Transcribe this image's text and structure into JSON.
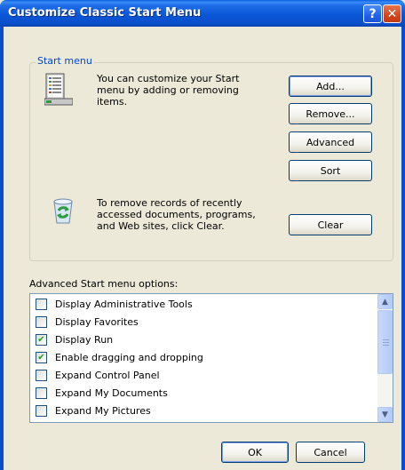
{
  "window": {
    "title": "Customize Classic Start Menu",
    "help_label": "?",
    "close_label": "✕"
  },
  "start_menu_group": {
    "legend": "Start menu",
    "customize_text": [
      "You can customize your Start",
      "menu by adding or removing",
      "items."
    ],
    "clear_text": [
      "To remove records of recently",
      "accessed documents, programs,",
      "and Web sites, click Clear."
    ],
    "buttons": {
      "add": "Add...",
      "remove": "Remove...",
      "advanced": "Advanced",
      "sort": "Sort",
      "clear": "Clear"
    }
  },
  "advanced": {
    "label": "Advanced Start menu options:",
    "options": [
      {
        "label": "Display Administrative Tools",
        "checked": false
      },
      {
        "label": "Display Favorites",
        "checked": false
      },
      {
        "label": "Display Run",
        "checked": true
      },
      {
        "label": "Enable dragging and dropping",
        "checked": true
      },
      {
        "label": "Expand Control Panel",
        "checked": false
      },
      {
        "label": "Expand My Documents",
        "checked": false
      },
      {
        "label": "Expand My Pictures",
        "checked": false
      }
    ]
  },
  "footer": {
    "ok": "OK",
    "cancel": "Cancel"
  },
  "icons": {
    "start_menu": "start-menu-icon",
    "recycle": "recycle-bin-icon"
  },
  "colors": {
    "title_bar": "#0a4ec8",
    "dialog_bg": "#ece9d8",
    "legend_text": "#0046d5",
    "button_border": "#003c74",
    "close_button": "#d6451c"
  }
}
